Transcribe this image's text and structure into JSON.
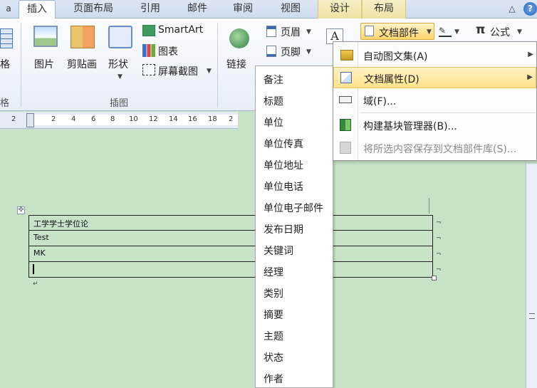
{
  "tabs": [
    "插入",
    "页面布局",
    "引用",
    "邮件",
    "审阅",
    "视图",
    "设计",
    "布局"
  ],
  "ribbon": {
    "table_label": "格",
    "table_group": "格",
    "picture": "图片",
    "clipart": "剪贴画",
    "shapes": "形状",
    "smartart": "SmartArt",
    "chart": "图表",
    "screenshot": "屏幕截图",
    "illustrations_group": "插图",
    "link": "链接",
    "header": "页眉",
    "footer": "页脚",
    "docparts": "文档部件",
    "formula": "公式",
    "formula_symbol": "π",
    "textbox_glyph": "A"
  },
  "ruler_numbers": [
    "2",
    "2",
    "4",
    "6",
    "8",
    "10",
    "12",
    "14",
    "16",
    "18",
    "2"
  ],
  "table_rows": [
    "工学学士学位论",
    "Test",
    "MK",
    ""
  ],
  "field_list": [
    "备注",
    "标题",
    "单位",
    "单位传真",
    "单位地址",
    "单位电话",
    "单位电子邮件",
    "发布日期",
    "关键词",
    "经理",
    "类别",
    "摘要",
    "主题",
    "状态",
    "作者"
  ],
  "menu": [
    {
      "label": "自动图文集(A)",
      "arrow": "▶",
      "disabled": false,
      "highlight": false
    },
    {
      "label": "文档属性(D)",
      "arrow": "▶",
      "disabled": false,
      "highlight": true
    },
    {
      "label": "域(F)...",
      "arrow": "",
      "disabled": false,
      "highlight": false
    },
    {
      "label": "构建基块管理器(B)...",
      "arrow": "",
      "disabled": false,
      "highlight": false
    },
    {
      "label": "将所选内容保存到文档部件库(S)...",
      "arrow": "",
      "disabled": true,
      "highlight": false
    }
  ]
}
